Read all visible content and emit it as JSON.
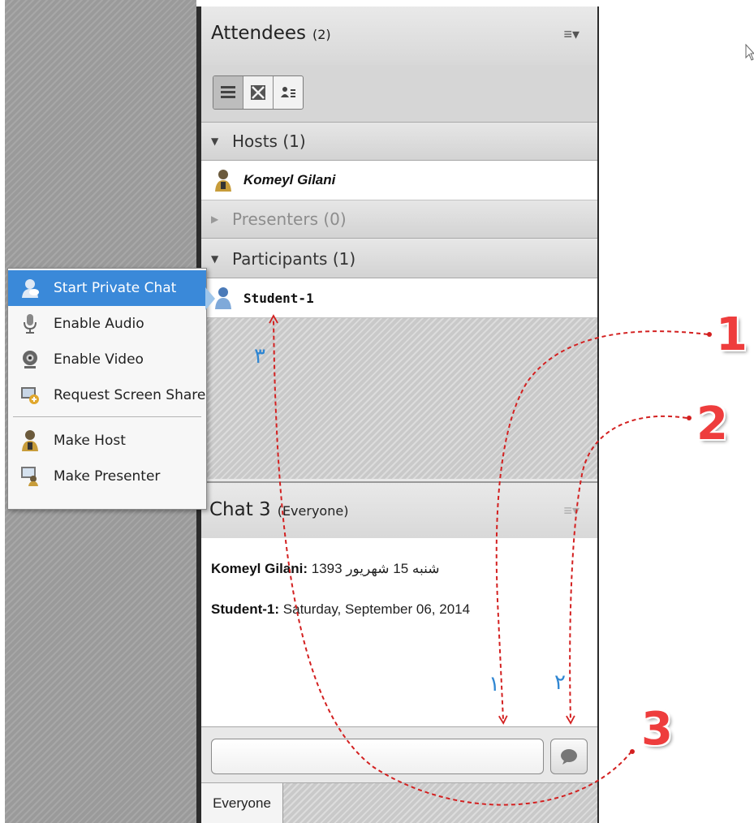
{
  "attendees_pod": {
    "title": "Attendees",
    "count": "(2)",
    "sections": {
      "hosts": "Hosts (1)",
      "presenters": "Presenters (0)",
      "participants": "Participants (1)"
    },
    "host_name": "Komeyl Gilani",
    "participant_name": "Student-1"
  },
  "view_modes": [
    "attendee-list-view-icon",
    "attendee-grid-view-icon",
    "attendee-status-view-icon"
  ],
  "context_menu": {
    "items": [
      "Start Private Chat",
      "Enable Audio",
      "Enable Video",
      "Request Screen Share",
      "Make Host",
      "Make Presenter"
    ],
    "highlighted": "Start Private Chat"
  },
  "chat_pod": {
    "title": "Chat 3",
    "audience": "(Everyone)",
    "messages": [
      {
        "sender": "Komeyl Gilani:",
        "text": "شنبه 15 شهریور 1393"
      },
      {
        "sender": "Student-1:",
        "text": "Saturday, September 06, 2014"
      }
    ],
    "input_value": "",
    "tabs": [
      "Everyone"
    ]
  },
  "annotations": {
    "big_numbers": [
      "1",
      "2",
      "3"
    ],
    "small_numbers": [
      "۱",
      "۲",
      "۳"
    ],
    "arrow_color": "#d32020",
    "number_color": "#ee3d3d",
    "small_number_color": "#2f86d2"
  },
  "colors": {
    "menu_highlight": "#3a89d9",
    "panel_border": "#2b2b2b"
  }
}
